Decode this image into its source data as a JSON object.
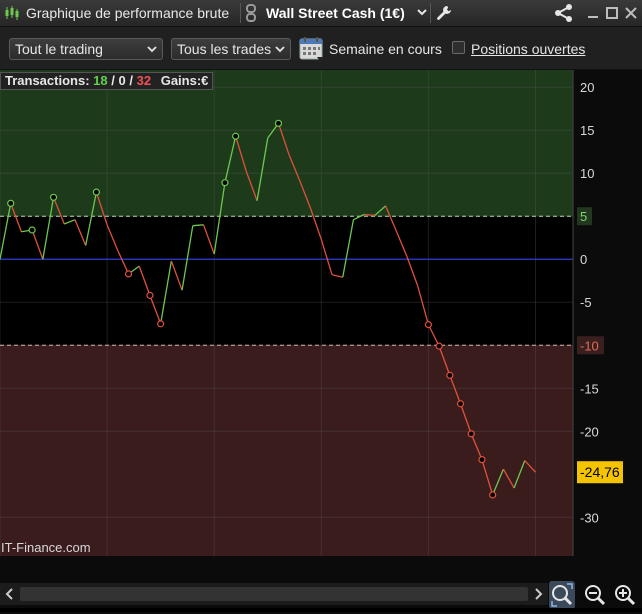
{
  "titlebar": {
    "title": "Graphique de performance brute",
    "instrument": "Wall Street Cash (1€)",
    "icons": [
      "candlestick-icon",
      "link-icon",
      "chevron-down-icon",
      "wrench-icon",
      "share-icon",
      "minimize-icon",
      "maximize-icon",
      "close-icon"
    ]
  },
  "toolbar": {
    "scope_select": "Tout le trading",
    "trades_select": "Tous les trades",
    "week_label": "Semaine en cours",
    "positions_label": "Positions ouvertes",
    "positions_checked": false
  },
  "stats": {
    "transactions_label": "Transactions:",
    "wins": "18",
    "sep1": "/",
    "neutral": "0",
    "sep2": "/",
    "losses": "32",
    "gains_label": "Gains:",
    "gains_unit": "€"
  },
  "watermark": "IT-Finance.com",
  "colors": {
    "profit_zone": "#1d3b1b",
    "loss_zone": "#3b1c1c",
    "up_line": "#6cc84f",
    "down_line": "#e0503c",
    "zero_line": "#2a3fd0",
    "last_value_bg": "#f5c400"
  },
  "chart_data": {
    "type": "line",
    "xlabel": "",
    "ylabel": "",
    "xlim": [
      0,
      53.5
    ],
    "ylim": [
      -34.5,
      22
    ],
    "x_ticks": [
      "0",
      "10",
      "20",
      "30",
      "40",
      "50"
    ],
    "y_ticks": [
      "20",
      "15",
      "10",
      "5",
      "0",
      "-5",
      "-10",
      "-15",
      "-20",
      "-30"
    ],
    "upper_threshold": 5,
    "lower_threshold": -10,
    "upper_threshold_label": "5",
    "lower_threshold_label": "-10",
    "last_value_label": "-24,76",
    "last_value": -24.76,
    "x": [
      0,
      1,
      2,
      3,
      4,
      5,
      6,
      7,
      8,
      9,
      10,
      11,
      12,
      13,
      14,
      15,
      16,
      17,
      18,
      19,
      20,
      21,
      22,
      23,
      24,
      25,
      26,
      27,
      28,
      29,
      30,
      31,
      32,
      33,
      34,
      35,
      36,
      37,
      38,
      39,
      40,
      41,
      42,
      43,
      44,
      45,
      46,
      47,
      48,
      49,
      50
    ],
    "y": [
      0,
      6.5,
      3.2,
      3.4,
      0,
      7.2,
      4.1,
      4.6,
      1.6,
      7.8,
      4,
      1,
      -1.7,
      -0.8,
      -4.2,
      -7.5,
      -0.2,
      -3.6,
      3.9,
      4,
      0.6,
      8.9,
      14.3,
      10.2,
      6.8,
      14.1,
      15.8,
      12.1,
      9.1,
      5.9,
      2.3,
      -1.8,
      -2.1,
      4.6,
      5.2,
      5.1,
      6.2,
      3.3,
      0.3,
      -3.1,
      -7.6,
      -10.1,
      -13.5,
      -16.8,
      -20.3,
      -23.3,
      -27.4,
      -24.4,
      -26.6,
      -23.4,
      -24.76
    ],
    "markers_x": [
      1,
      3,
      5,
      9,
      12,
      14,
      15,
      21,
      22,
      26,
      40,
      41,
      42,
      43,
      44,
      45,
      46
    ]
  },
  "scrollbar": {
    "left_arrow": "scroll-left-icon",
    "right_arrow": "scroll-right-icon"
  },
  "zoom": {
    "icons": [
      "zoom-fit-icon",
      "zoom-out-icon",
      "zoom-in-icon"
    ]
  }
}
